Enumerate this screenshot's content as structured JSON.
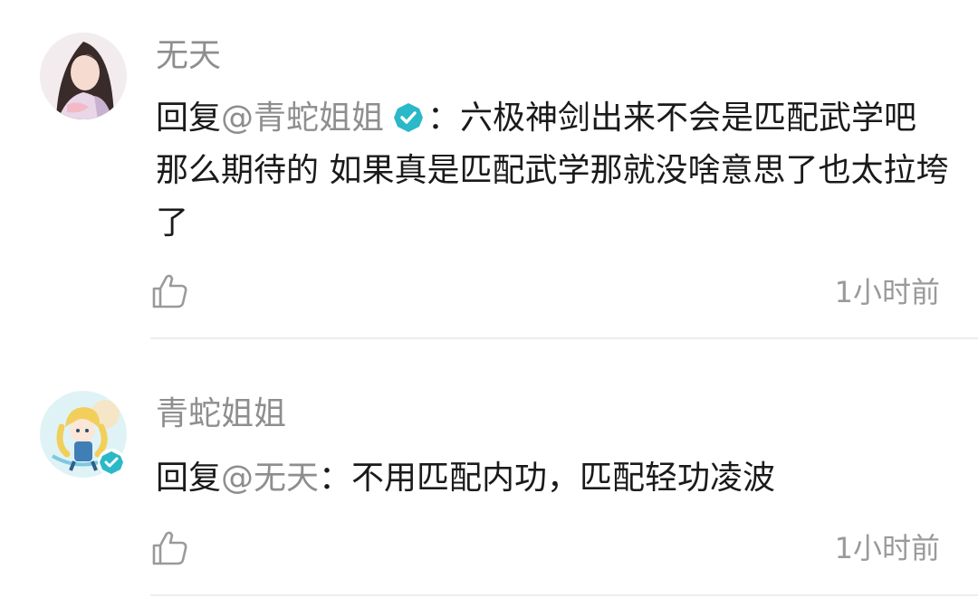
{
  "comments": [
    {
      "username": "无天",
      "reply_prefix": "回复",
      "mention": "@青蛇姐姐",
      "mention_verified": true,
      "separator": "：",
      "text": "六极神剑出来不会是匹配武学吧 那么期待的 如果真是匹配武学那就没啥意思了也太拉垮了",
      "timestamp": "1小时前",
      "like_icon": "thumbs-up-icon"
    },
    {
      "username": "青蛇姐姐",
      "verified": true,
      "reply_prefix": "回复",
      "mention": "@无天",
      "separator": "：",
      "text": "不用匹配内功，匹配轻功凌波",
      "timestamp": "1小时前",
      "like_icon": "thumbs-up-icon"
    }
  ],
  "colors": {
    "verified_badge": "#2bb8c8",
    "username": "#8e8e8e",
    "body_text": "#1a1a1a",
    "divider": "#ededed"
  }
}
